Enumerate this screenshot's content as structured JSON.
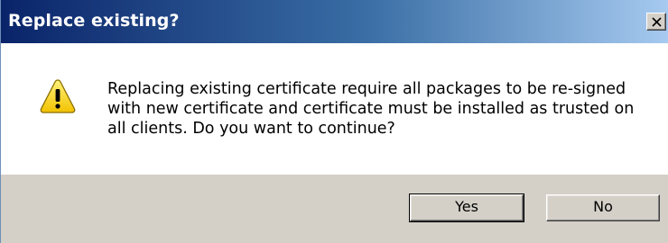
{
  "dialog": {
    "title": "Replace existing?",
    "close_icon": "close-icon",
    "icon": "warning-icon",
    "message_lines": [
      "Replacing existing certificate require all packages to be re-signed",
      "with new certificate and certificate must be installed as trusted on",
      "all clients. Do you want to continue?"
    ],
    "buttons": {
      "yes_label": "Yes",
      "no_label": "No"
    }
  },
  "colors": {
    "titlebar_start": "#0a246a",
    "titlebar_end": "#a6caf0",
    "face": "#d4d0c8",
    "warning_fill": "#f5d000"
  }
}
